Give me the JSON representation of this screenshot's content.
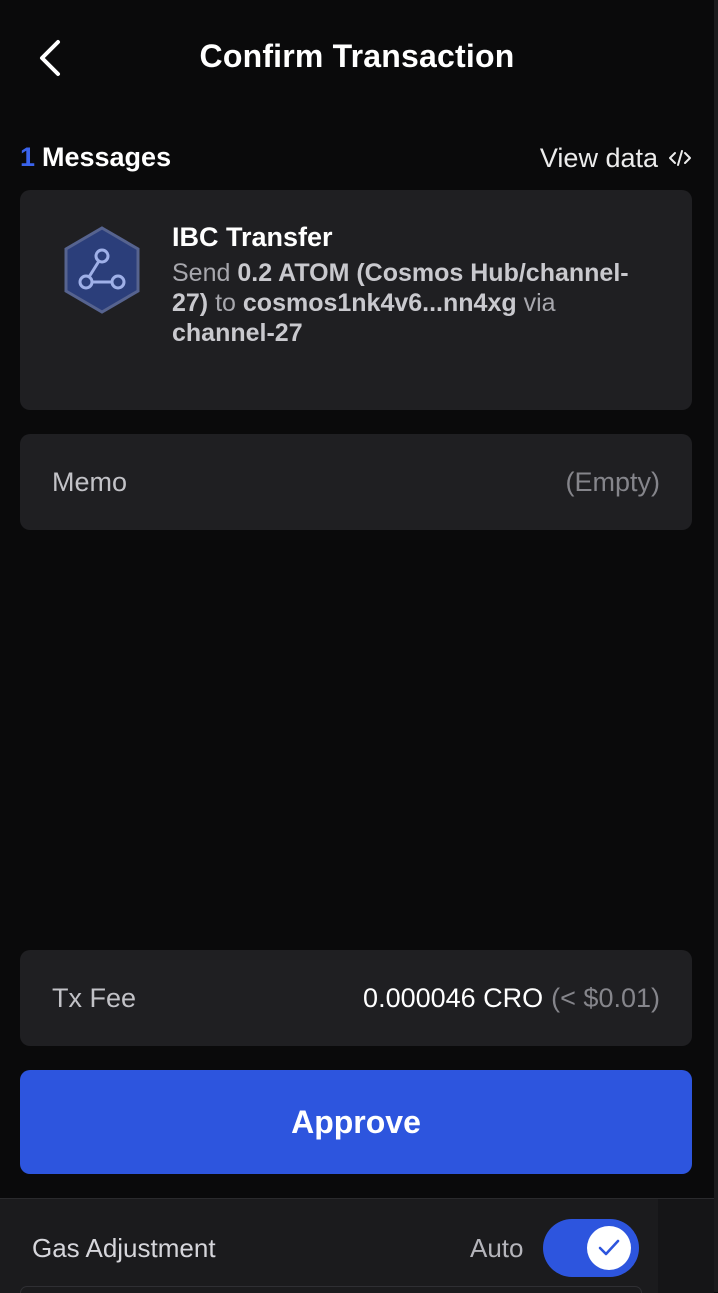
{
  "header": {
    "title": "Confirm Transaction",
    "back_icon": "chevron-left-icon"
  },
  "messages": {
    "count": "1",
    "label": "Messages",
    "view_data_label": "View data",
    "view_data_icon": "code-icon"
  },
  "message_card": {
    "icon": "ibc-transfer-icon",
    "title": "IBC Transfer",
    "desc_send": "Send ",
    "desc_amount": "0.2 ATOM (Cosmos Hub/channel-27)",
    "desc_to": " to ",
    "desc_address": "cosmos1nk4v6...nn4xg",
    "desc_via": " via ",
    "desc_channel": "channel-27"
  },
  "memo": {
    "label": "Memo",
    "value": "(Empty)"
  },
  "fee": {
    "label": "Tx Fee",
    "amount": "0.000046 CRO",
    "usd": "(< $0.01)"
  },
  "approve": {
    "label": "Approve"
  },
  "gas": {
    "label": "Gas Adjustment",
    "auto_label": "Auto",
    "auto_enabled": true,
    "check_icon": "checkmark-icon"
  },
  "colors": {
    "background": "#0a0a0b",
    "card": "#1f1f22",
    "accent": "#2d55de",
    "count_blue": "#3a63ec"
  }
}
